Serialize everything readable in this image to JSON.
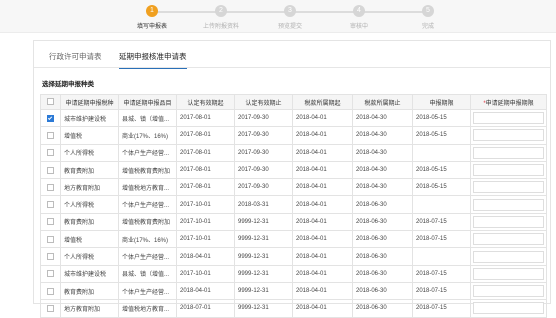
{
  "steps": [
    {
      "num": "1",
      "label": "填写申报表",
      "active": true
    },
    {
      "num": "2",
      "label": "上传附报资料",
      "active": false
    },
    {
      "num": "3",
      "label": "预览提交",
      "active": false
    },
    {
      "num": "4",
      "label": "审核中",
      "active": false
    },
    {
      "num": "5",
      "label": "完成",
      "active": false
    }
  ],
  "tabs": [
    {
      "label": "行政许可申请表",
      "active": false
    },
    {
      "label": "延期申报核准申请表",
      "active": true
    }
  ],
  "section_title": "选择延期申报种类",
  "table": {
    "headers": [
      "申请延期申报税种",
      "申请延期申报品目",
      "认定有效期起",
      "认定有效期止",
      "税款所属期起",
      "税款所属期止",
      "申报期限",
      "申请延期申报期限"
    ],
    "required_marker": "*",
    "rows": [
      {
        "checked": true,
        "cells": [
          "城市维护建设税",
          "县城、镇（增值...",
          "2017-08-01",
          "2017-09-30",
          "2018-04-01",
          "2018-04-30",
          "2018-05-15",
          ""
        ]
      },
      {
        "checked": false,
        "cells": [
          "增值税",
          "商业(17%、16%)",
          "2017-08-01",
          "2017-09-30",
          "2018-04-01",
          "2018-04-30",
          "2018-05-15",
          ""
        ]
      },
      {
        "checked": false,
        "cells": [
          "个人所得税",
          "个体户生产经营...",
          "2017-08-01",
          "2017-09-30",
          "2018-04-01",
          "2018-04-30",
          "",
          ""
        ]
      },
      {
        "checked": false,
        "cells": [
          "教育费附加",
          "增值税教育费附加",
          "2017-08-01",
          "2017-09-30",
          "2018-04-01",
          "2018-04-30",
          "2018-05-15",
          ""
        ]
      },
      {
        "checked": false,
        "cells": [
          "地方教育附加",
          "增值税地方教育...",
          "2017-08-01",
          "2017-09-30",
          "2018-04-01",
          "2018-04-30",
          "2018-05-15",
          ""
        ]
      },
      {
        "checked": false,
        "cells": [
          "个人所得税",
          "个体户生产经营...",
          "2017-10-01",
          "2018-03-31",
          "2018-04-01",
          "2018-06-30",
          "",
          ""
        ]
      },
      {
        "checked": false,
        "cells": [
          "教育费附加",
          "增值税教育费附加",
          "2017-10-01",
          "9999-12-31",
          "2018-04-01",
          "2018-06-30",
          "2018-07-15",
          ""
        ]
      },
      {
        "checked": false,
        "cells": [
          "增值税",
          "商业(17%、16%)",
          "2017-10-01",
          "9999-12-31",
          "2018-04-01",
          "2018-06-30",
          "2018-07-15",
          ""
        ]
      },
      {
        "checked": false,
        "cells": [
          "个人所得税",
          "个体户生产经营...",
          "2018-04-01",
          "9999-12-31",
          "2018-04-01",
          "2018-06-30",
          "",
          ""
        ]
      },
      {
        "checked": false,
        "cells": [
          "城市维护建设税",
          "县城、镇（增值...",
          "2017-10-01",
          "9999-12-31",
          "2018-04-01",
          "2018-06-30",
          "2018-07-15",
          ""
        ]
      },
      {
        "checked": false,
        "cells": [
          "教育费附加",
          "个体户生产经营...",
          "2018-04-01",
          "9999-12-31",
          "2018-04-01",
          "2018-06-30",
          "2018-07-15",
          ""
        ]
      },
      {
        "checked": false,
        "cells": [
          "地方教育附加",
          "增值税地方教育...",
          "2018-07-01",
          "9999-12-31",
          "2018-04-01",
          "2018-06-30",
          "2018-07-15",
          ""
        ]
      }
    ]
  }
}
